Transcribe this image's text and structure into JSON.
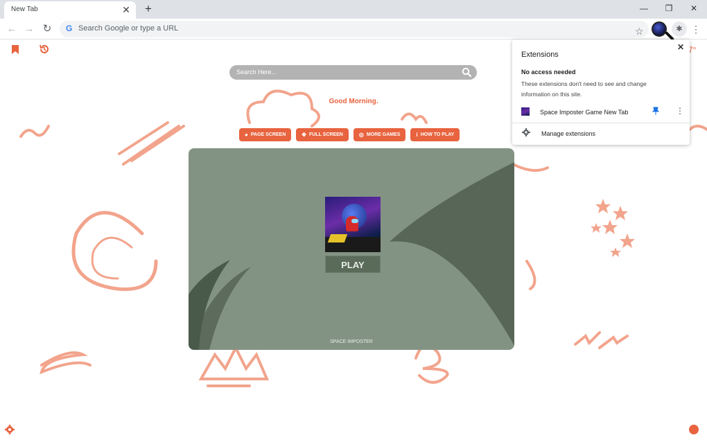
{
  "browser": {
    "tab": {
      "title": "New Tab",
      "close_glyph": "✕"
    },
    "new_tab_glyph": "+",
    "window": {
      "minimize": "—",
      "restore": "❐",
      "close": "✕"
    },
    "nav": {
      "back": "←",
      "forward": "→",
      "reload": "↻"
    },
    "omnibox": {
      "placeholder": "Search Google or type a URL",
      "logo": "G"
    },
    "star_glyph": "☆",
    "puzzle_glyph": "✱",
    "menu_glyph": "⋮"
  },
  "page": {
    "accent_color": "#e8633f",
    "search": {
      "placeholder": "Search Here..."
    },
    "greeting": "Good Morning.",
    "weather_partial": "7°",
    "buttons": [
      {
        "label": "PAGE SCREEN",
        "icon": "bulb-icon",
        "glyph": "●"
      },
      {
        "label": "FULL SCREEN",
        "icon": "move-icon",
        "glyph": "✥"
      },
      {
        "label": "MORE GAMES",
        "icon": "gamepad-icon",
        "glyph": "◎"
      },
      {
        "label": "HOW TO PLAY",
        "icon": "info-icon",
        "glyph": "i"
      }
    ],
    "game": {
      "play_label": "PLAY",
      "title": "SPACE IMPOSTER",
      "bg_color": "#839383"
    }
  },
  "extensions_popup": {
    "title": "Extensions",
    "close_glyph": "✕",
    "section_title": "No access needed",
    "section_desc": "These extensions don't need to see and change information on this site.",
    "extension_name": "Space Imposter Game New Tab",
    "pin_glyph": "📌",
    "more_glyph": "⋮",
    "manage_label": "Manage extensions"
  }
}
